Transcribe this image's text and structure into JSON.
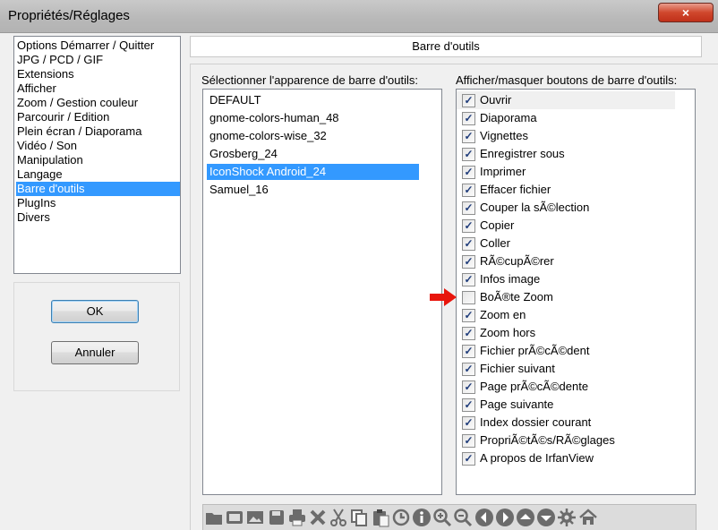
{
  "window": {
    "title": "Propriétés/Réglages",
    "close_icon": "×"
  },
  "nav": {
    "items": [
      "Options Démarrer / Quitter",
      "JPG / PCD / GIF",
      "Extensions",
      "Afficher",
      "Zoom / Gestion couleur",
      "Parcourir / Edition",
      "Plein écran / Diaporama",
      "Vidéo / Son",
      "Manipulation",
      "Langage",
      "Barre d'outils",
      "PlugIns",
      "Divers"
    ],
    "selected": "Barre d'outils"
  },
  "buttons": {
    "ok": "OK",
    "cancel": "Annuler"
  },
  "header": {
    "title": "Barre d'outils"
  },
  "appearance": {
    "label": "Sélectionner l'apparence de barre d'outils:",
    "items": [
      "DEFAULT",
      "gnome-colors-human_48",
      "gnome-colors-wise_32",
      "Grosberg_24",
      "IconShock Android_24",
      "Samuel_16"
    ],
    "selected": "IconShock Android_24"
  },
  "toolbar_buttons": {
    "label": "Afficher/masquer boutons de barre d'outils:",
    "items": [
      {
        "label": "Ouvrir",
        "checked": true
      },
      {
        "label": "Diaporama",
        "checked": true
      },
      {
        "label": "Vignettes",
        "checked": true
      },
      {
        "label": "Enregistrer sous",
        "checked": true
      },
      {
        "label": "Imprimer",
        "checked": true
      },
      {
        "label": "Effacer fichier",
        "checked": true
      },
      {
        "label": "Couper la sÃ©lection",
        "checked": true
      },
      {
        "label": "Copier",
        "checked": true
      },
      {
        "label": "Coller",
        "checked": true
      },
      {
        "label": "RÃ©cupÃ©rer",
        "checked": true
      },
      {
        "label": "Infos image",
        "checked": true
      },
      {
        "label": "BoÃ®te Zoom",
        "checked": false
      },
      {
        "label": "Zoom en",
        "checked": true
      },
      {
        "label": "Zoom hors",
        "checked": true
      },
      {
        "label": "Fichier prÃ©cÃ©dent",
        "checked": true
      },
      {
        "label": "Fichier suivant",
        "checked": true
      },
      {
        "label": "Page prÃ©cÃ©dente",
        "checked": true
      },
      {
        "label": "Page suivante",
        "checked": true
      },
      {
        "label": "Index dossier courant",
        "checked": true
      },
      {
        "label": "PropriÃ©tÃ©s/RÃ©glages",
        "checked": true
      },
      {
        "label": "A propos de IrfanView",
        "checked": true
      }
    ]
  },
  "toolbar_preview": {
    "icons": [
      "open-folder-icon",
      "slideshow-icon",
      "thumbnails-icon",
      "save-icon",
      "print-icon",
      "delete-icon",
      "cut-icon",
      "copy-icon",
      "paste-icon",
      "undo-icon",
      "info-icon",
      "zoom-in-icon",
      "zoom-out-icon",
      "previous-icon",
      "next-icon",
      "previous-page-icon",
      "next-page-icon",
      "settings-icon",
      "home-icon"
    ]
  },
  "colors": {
    "selection": "#3399ff",
    "arrow": "#e8150c"
  }
}
